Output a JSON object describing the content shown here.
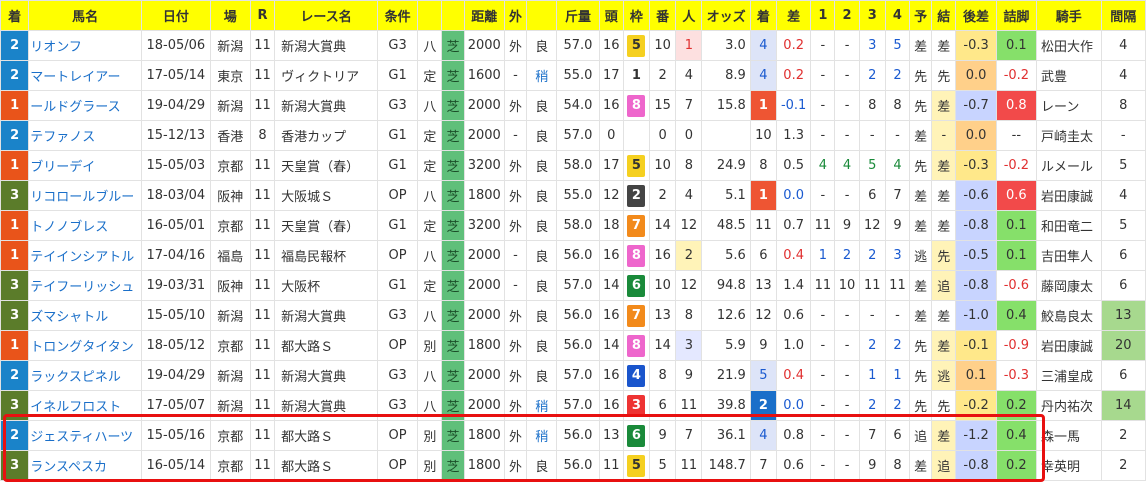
{
  "headers": [
    "着",
    "馬名",
    "日付",
    "場",
    "R",
    "レース名",
    "条件",
    "",
    "",
    "距離",
    "外",
    "",
    "斤量",
    "頭",
    "枠",
    "番",
    "人",
    "オッズ",
    "着",
    "差",
    "1",
    "2",
    "3",
    "4",
    "予",
    "結",
    "後差",
    "詰脚",
    "騎手",
    "間隔"
  ],
  "rows": [
    {
      "rank": "2",
      "horse": "リオンフ",
      "date": "18-05/06",
      "venue": "新潟",
      "r": "11",
      "race": "新潟大賞典",
      "grade": "G3",
      "cond": "八",
      "surface": "芝",
      "dist": "2000",
      "io": "外",
      "going": "良",
      "weight": "57.0",
      "heads": "16",
      "frame": "5",
      "num": "10",
      "pop": "1",
      "odds": "3.0",
      "fin": "4",
      "diff": "0.2",
      "p1": "-",
      "p2": "-",
      "p3": "3",
      "p4": "5",
      "pred": "差",
      "res": "差",
      "ato": "-0.3",
      "tume": "0.1",
      "jockey": "松田大作",
      "interval": "4"
    },
    {
      "rank": "2",
      "horse": "マートレイアー",
      "date": "17-05/14",
      "venue": "東京",
      "r": "11",
      "race": "ヴィクトリア",
      "grade": "G1",
      "cond": "定",
      "surface": "芝",
      "dist": "1600",
      "io": "-",
      "going": "稍",
      "weight": "55.0",
      "heads": "17",
      "frame": "1",
      "num": "2",
      "pop": "4",
      "odds": "8.9",
      "fin": "4",
      "diff": "0.2",
      "p1": "-",
      "p2": "-",
      "p3": "2",
      "p4": "2",
      "pred": "先",
      "res": "先",
      "ato": "0.0",
      "tume": "-0.2",
      "jockey": "武豊",
      "interval": "4"
    },
    {
      "rank": "1",
      "horse": "ールドグラース",
      "date": "19-04/29",
      "venue": "新潟",
      "r": "11",
      "race": "新潟大賞典",
      "grade": "G3",
      "cond": "八",
      "surface": "芝",
      "dist": "2000",
      "io": "外",
      "going": "良",
      "weight": "54.0",
      "heads": "16",
      "frame": "8",
      "num": "15",
      "pop": "7",
      "odds": "15.8",
      "fin": "1",
      "diff": "-0.1",
      "p1": "-",
      "p2": "-",
      "p3": "8",
      "p4": "8",
      "pred": "先",
      "res": "差",
      "ato": "-0.7",
      "tume": "0.8",
      "jockey": "レーン",
      "interval": "8"
    },
    {
      "rank": "2",
      "horse": "テファノス",
      "date": "15-12/13",
      "venue": "香港",
      "r": "8",
      "race": "香港カップ",
      "grade": "G1",
      "cond": "定",
      "surface": "芝",
      "dist": "2000",
      "io": "-",
      "going": "良",
      "weight": "57.0",
      "heads": "0",
      "frame": "",
      "num": "0",
      "pop": "0",
      "odds": "",
      "fin": "10",
      "diff": "1.3",
      "p1": "-",
      "p2": "-",
      "p3": "-",
      "p4": "-",
      "pred": "差",
      "res": "-",
      "ato": "0.0",
      "tume": "--",
      "jockey": "戸崎圭太",
      "interval": "-"
    },
    {
      "rank": "1",
      "horse": "ブリーデイ",
      "date": "15-05/03",
      "venue": "京都",
      "r": "11",
      "race": "天皇賞（春）",
      "grade": "G1",
      "cond": "定",
      "surface": "芝",
      "dist": "3200",
      "io": "外",
      "going": "良",
      "weight": "58.0",
      "heads": "17",
      "frame": "5",
      "num": "10",
      "pop": "8",
      "odds": "24.9",
      "fin": "8",
      "diff": "0.5",
      "p1": "4",
      "p2": "4",
      "p3": "5",
      "p4": "4",
      "pred": "先",
      "res": "差",
      "ato": "-0.3",
      "tume": "-0.2",
      "jockey": "ルメール",
      "interval": "5"
    },
    {
      "rank": "3",
      "horse": "リコロールブルー",
      "date": "18-03/04",
      "venue": "阪神",
      "r": "11",
      "race": "大阪城Ｓ",
      "grade": "OP",
      "cond": "八",
      "surface": "芝",
      "dist": "1800",
      "io": "外",
      "going": "良",
      "weight": "55.0",
      "heads": "12",
      "frame": "2",
      "num": "2",
      "pop": "4",
      "odds": "5.1",
      "fin": "1",
      "diff": "0.0",
      "p1": "-",
      "p2": "-",
      "p3": "6",
      "p4": "7",
      "pred": "差",
      "res": "差",
      "ato": "-0.6",
      "tume": "0.6",
      "jockey": "岩田康誠",
      "interval": "4"
    },
    {
      "rank": "1",
      "horse": "トノノブレス",
      "date": "16-05/01",
      "venue": "京都",
      "r": "11",
      "race": "天皇賞（春）",
      "grade": "G1",
      "cond": "定",
      "surface": "芝",
      "dist": "3200",
      "io": "外",
      "going": "良",
      "weight": "58.0",
      "heads": "18",
      "frame": "7",
      "num": "14",
      "pop": "12",
      "odds": "48.5",
      "fin": "11",
      "diff": "0.7",
      "p1": "11",
      "p2": "9",
      "p3": "12",
      "p4": "9",
      "pred": "差",
      "res": "差",
      "ato": "-0.8",
      "tume": "0.1",
      "jockey": "和田竜二",
      "interval": "5"
    },
    {
      "rank": "1",
      "horse": "テイインシアトル",
      "date": "17-04/16",
      "venue": "福島",
      "r": "11",
      "race": "福島民報杯",
      "grade": "OP",
      "cond": "八",
      "surface": "芝",
      "dist": "2000",
      "io": "-",
      "going": "良",
      "weight": "56.0",
      "heads": "16",
      "frame": "8",
      "num": "16",
      "pop": "2",
      "odds": "5.6",
      "fin": "6",
      "diff": "0.4",
      "p1": "1",
      "p2": "2",
      "p3": "2",
      "p4": "3",
      "pred": "逃",
      "res": "先",
      "ato": "-0.5",
      "tume": "0.1",
      "jockey": "吉田隼人",
      "interval": "6"
    },
    {
      "rank": "3",
      "horse": "テイフーリッシュ",
      "date": "19-03/31",
      "venue": "阪神",
      "r": "11",
      "race": "大阪杯",
      "grade": "G1",
      "cond": "定",
      "surface": "芝",
      "dist": "2000",
      "io": "-",
      "going": "良",
      "weight": "57.0",
      "heads": "14",
      "frame": "6",
      "num": "10",
      "pop": "12",
      "odds": "94.8",
      "fin": "13",
      "diff": "1.4",
      "p1": "11",
      "p2": "10",
      "p3": "11",
      "p4": "11",
      "pred": "差",
      "res": "追",
      "ato": "-0.8",
      "tume": "-0.6",
      "jockey": "藤岡康太",
      "interval": "6"
    },
    {
      "rank": "3",
      "horse": "ズマシャトル",
      "date": "15-05/10",
      "venue": "新潟",
      "r": "11",
      "race": "新潟大賞典",
      "grade": "G3",
      "cond": "八",
      "surface": "芝",
      "dist": "2000",
      "io": "外",
      "going": "良",
      "weight": "56.0",
      "heads": "16",
      "frame": "7",
      "num": "13",
      "pop": "8",
      "odds": "12.6",
      "fin": "12",
      "diff": "0.6",
      "p1": "-",
      "p2": "-",
      "p3": "-",
      "p4": "-",
      "pred": "差",
      "res": "差",
      "ato": "-1.0",
      "tume": "0.4",
      "jockey": "鮫島良太",
      "interval": "13"
    },
    {
      "rank": "1",
      "horse": "トロングタイタン",
      "date": "18-05/12",
      "venue": "京都",
      "r": "11",
      "race": "都大路Ｓ",
      "grade": "OP",
      "cond": "別",
      "surface": "芝",
      "dist": "1800",
      "io": "外",
      "going": "良",
      "weight": "56.0",
      "heads": "14",
      "frame": "8",
      "num": "14",
      "pop": "3",
      "odds": "5.9",
      "fin": "9",
      "diff": "1.0",
      "p1": "-",
      "p2": "-",
      "p3": "2",
      "p4": "2",
      "pred": "先",
      "res": "差",
      "ato": "-0.1",
      "tume": "-0.9",
      "jockey": "岩田康誠",
      "interval": "20"
    },
    {
      "rank": "2",
      "horse": "ラックスピネル",
      "date": "19-04/29",
      "venue": "新潟",
      "r": "11",
      "race": "新潟大賞典",
      "grade": "G3",
      "cond": "八",
      "surface": "芝",
      "dist": "2000",
      "io": "外",
      "going": "良",
      "weight": "57.0",
      "heads": "16",
      "frame": "4",
      "num": "8",
      "pop": "9",
      "odds": "21.9",
      "fin": "5",
      "diff": "0.4",
      "p1": "-",
      "p2": "-",
      "p3": "1",
      "p4": "1",
      "pred": "先",
      "res": "逃",
      "ato": "0.1",
      "tume": "-0.3",
      "jockey": "三浦皇成",
      "interval": "6"
    },
    {
      "rank": "3",
      "horse": "イネルフロスト",
      "date": "17-05/07",
      "venue": "新潟",
      "r": "11",
      "race": "新潟大賞典",
      "grade": "G3",
      "cond": "八",
      "surface": "芝",
      "dist": "2000",
      "io": "外",
      "going": "稍",
      "weight": "57.0",
      "heads": "16",
      "frame": "3",
      "num": "6",
      "pop": "11",
      "odds": "39.8",
      "fin": "2",
      "diff": "0.0",
      "p1": "-",
      "p2": "-",
      "p3": "2",
      "p4": "2",
      "pred": "先",
      "res": "先",
      "ato": "-0.2",
      "tume": "0.2",
      "jockey": "丹内祐次",
      "interval": "14"
    },
    {
      "rank": "2",
      "horse": "ジェスティハーツ",
      "date": "15-05/16",
      "venue": "京都",
      "r": "11",
      "race": "都大路Ｓ",
      "grade": "OP",
      "cond": "別",
      "surface": "芝",
      "dist": "1800",
      "io": "外",
      "going": "稍",
      "weight": "56.0",
      "heads": "13",
      "frame": "6",
      "num": "9",
      "pop": "7",
      "odds": "36.1",
      "fin": "4",
      "diff": "0.8",
      "p1": "-",
      "p2": "-",
      "p3": "7",
      "p4": "6",
      "pred": "追",
      "res": "差",
      "ato": "-1.2",
      "tume": "0.4",
      "jockey": "森一馬",
      "interval": "2"
    },
    {
      "rank": "3",
      "horse": "ランスペスカ",
      "date": "16-05/14",
      "venue": "京都",
      "r": "11",
      "race": "都大路Ｓ",
      "grade": "OP",
      "cond": "別",
      "surface": "芝",
      "dist": "1800",
      "io": "外",
      "going": "良",
      "weight": "56.0",
      "heads": "11",
      "frame": "5",
      "num": "5",
      "pop": "11",
      "odds": "148.7",
      "fin": "7",
      "diff": "0.6",
      "p1": "-",
      "p2": "-",
      "p3": "9",
      "p4": "8",
      "pred": "差",
      "res": "追",
      "ato": "-0.8",
      "tume": "0.2",
      "jockey": "幸英明",
      "interval": "2"
    }
  ],
  "colors": {
    "header": "#ffff00",
    "link": "#1a6fc9",
    "highlight_box": "#e81010",
    "turf": "#5fbf7a"
  }
}
